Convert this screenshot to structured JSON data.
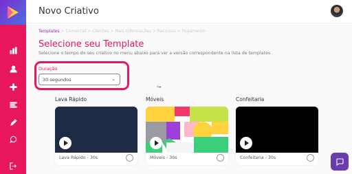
{
  "header": {
    "title": "Novo Criativo"
  },
  "breadcrumb": {
    "active": "Templates",
    "rest": " > Comercial > Clientes > Mais Informações > Recursos > Pagamento"
  },
  "page": {
    "title": "Selecione seu Template",
    "subtitle": "Selecione o tempo do seu criativo no menu abaixo para ver a versão correspondente na lista de templates ."
  },
  "duration": {
    "label": "Duração",
    "selected": "30 segundos"
  },
  "templates": [
    {
      "title": "Lava Rápido",
      "caption": "Lava Rápido - 30s"
    },
    {
      "title": "Móveis",
      "caption": "Móveis - 30s"
    },
    {
      "title": "Confeitaria",
      "caption": "Confeitaria - 30s"
    }
  ],
  "sidebar": {
    "icons": [
      "bar-chart-icon",
      "user-icon",
      "plus-icon",
      "menu-lines-icon",
      "pencil-icon",
      "whatsapp-icon",
      "logout-icon"
    ]
  },
  "colors": {
    "brand": "#e8175d",
    "chat": "#6a3dad",
    "navy_thumb": "#1f2b44"
  }
}
